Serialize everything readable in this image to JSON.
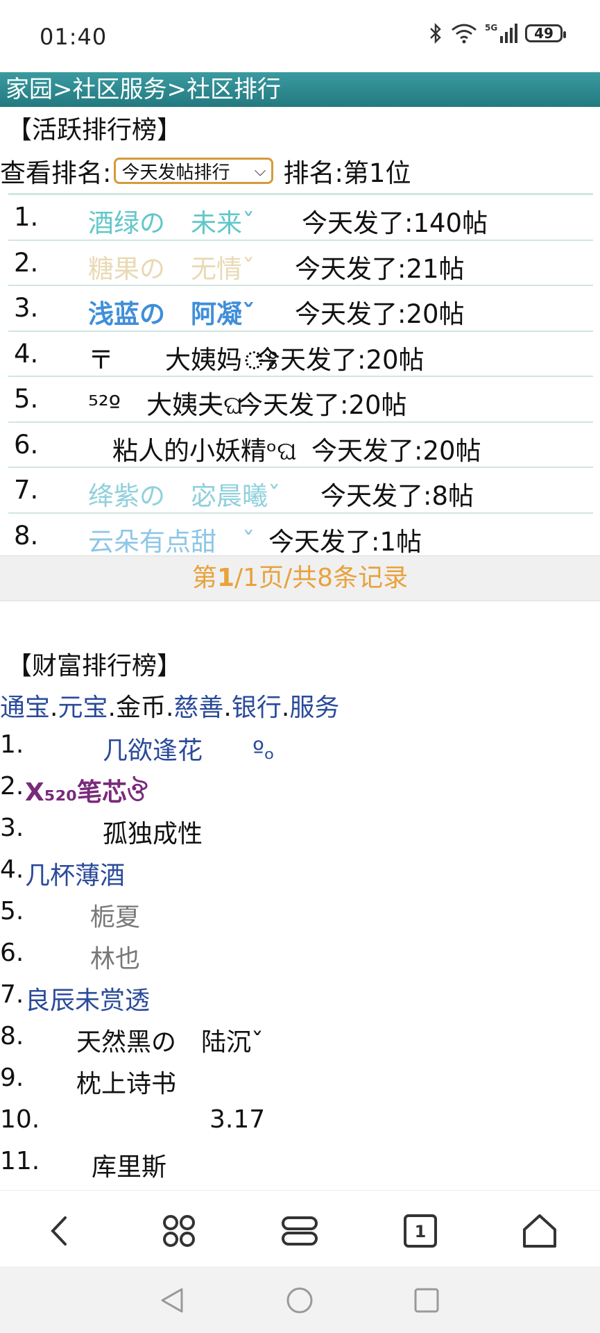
{
  "status_bar": {
    "time": "01:40",
    "battery": "49",
    "network": "5G"
  },
  "breadcrumb": "家园>社区服务>社区排行",
  "active_board": {
    "title": "【活跃排行榜】",
    "view_label": "查看排名:",
    "select_value": "今天发帖排行",
    "rank_text": "排名:第1位",
    "rows": [
      {
        "idx": "1.",
        "name": "酒绿の　未来ˇ",
        "color": "#62c7c9",
        "count": "今天发了:140帖"
      },
      {
        "idx": "2.",
        "name": "糖果の　无情ˇ",
        "color": "#e9d9b4",
        "count": "今天发了:21帖"
      },
      {
        "idx": "3.",
        "name": "浅蓝の　阿凝ˇ",
        "color": "#3f8fd9",
        "count": "今天发了:20帖"
      },
      {
        "idx": "4.",
        "name": "〒　　大姨妈ঃ",
        "color": "#111111",
        "count": "今天发了:20帖"
      },
      {
        "idx": "5.",
        "name": "⁵²º　大姨夫ଘ",
        "color": "#111111",
        "count": "今天发了:20帖"
      },
      {
        "idx": "6.",
        "name": "粘人的小妖精ᵒଘ",
        "color": "#111111",
        "count": "今天发了:20帖"
      },
      {
        "idx": "7.",
        "name": "绛紫の　宓晨曦ˇ",
        "color": "#8fd1dc",
        "count": "今天发了:8帖"
      },
      {
        "idx": "8.",
        "name": "云朵有点甜　ˇ",
        "color": "#8ec6e6",
        "count": "今天发了:1帖"
      }
    ]
  },
  "pager": {
    "prefix": "第",
    "current": "1",
    "rest": "/1页/共8条记录"
  },
  "wealth_board": {
    "title": "【财富排行榜】",
    "links": [
      {
        "label": "通宝",
        "type": "lnk"
      },
      {
        "label": ".",
        "type": "cur"
      },
      {
        "label": "元宝",
        "type": "lnk"
      },
      {
        "label": ".",
        "type": "cur"
      },
      {
        "label": "金币",
        "type": "cur"
      },
      {
        "label": ".",
        "type": "cur"
      },
      {
        "label": "慈善",
        "type": "lnk"
      },
      {
        "label": ".",
        "type": "cur"
      },
      {
        "label": "银行",
        "type": "lnk"
      },
      {
        "label": ".",
        "type": "cur"
      },
      {
        "label": "服务",
        "type": "lnk"
      }
    ],
    "rows": [
      {
        "idx": "1.",
        "name": "几欲逢花　　ºₒ",
        "color": "#2a4a9a"
      },
      {
        "idx": "2.",
        "name": "X₅₂₀笔芯ঔ",
        "color": "#7a2a7a"
      },
      {
        "idx": "3.",
        "name": "孤独成性",
        "color": "#111111"
      },
      {
        "idx": "4.",
        "name": "几杯薄酒",
        "color": "#2a4a9a"
      },
      {
        "idx": "5.",
        "name": "栀夏",
        "color": "#777777"
      },
      {
        "idx": "6.",
        "name": "林也",
        "color": "#777777"
      },
      {
        "idx": "7.",
        "name": "良辰未赏透",
        "color": "#2a4a9a"
      },
      {
        "idx": "8.",
        "name": "天然黑の　陆沉ˇ",
        "color": "#111111"
      },
      {
        "idx": "9.",
        "name": "枕上诗书",
        "color": "#111111"
      },
      {
        "idx": "10.",
        "name": "3.17",
        "color": "#111111"
      },
      {
        "idx": "11.",
        "name": "库里斯",
        "color": "#111111"
      }
    ]
  },
  "toolbar": {
    "tabs_count": "1"
  },
  "colors": {
    "header": "#2a8a90",
    "pager_text": "#e8a23c",
    "link": "#2a4a9a",
    "select_border": "#d69a3a"
  }
}
